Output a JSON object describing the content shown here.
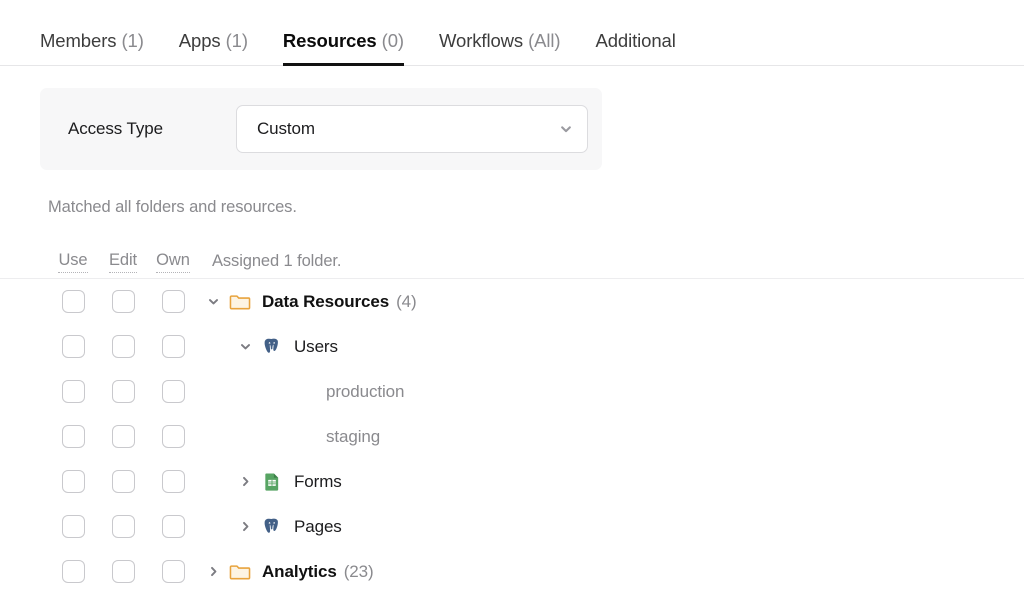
{
  "tabs": [
    {
      "label": "Members",
      "count": "(1)",
      "active": false
    },
    {
      "label": "Apps",
      "count": "(1)",
      "active": false
    },
    {
      "label": "Resources",
      "count": "(0)",
      "active": true
    },
    {
      "label": "Workflows",
      "count": "(All)",
      "active": false
    },
    {
      "label": "Additional",
      "count": "",
      "active": false
    }
  ],
  "access": {
    "label": "Access Type",
    "value": "Custom",
    "chevron_icon": "chevron-down-icon",
    "options": [
      "Custom"
    ]
  },
  "matched_note": "Matched all folders and resources.",
  "permissions": [
    {
      "key": "use",
      "label": "Use"
    },
    {
      "key": "edit",
      "label": "Edit"
    },
    {
      "key": "own",
      "label": "Own"
    }
  ],
  "assigned_note": "Assigned 1 folder.",
  "tree": [
    {
      "label": "Data Resources",
      "count": "(4)",
      "icon": "folder-icon",
      "kind": "folder",
      "depth": 0,
      "twisty": "expanded",
      "use": false,
      "edit": false,
      "own": false
    },
    {
      "label": "Users",
      "count": "",
      "icon": "postgresql-icon",
      "kind": "resource",
      "depth": 1,
      "twisty": "expanded",
      "use": false,
      "edit": false,
      "own": false
    },
    {
      "label": "production",
      "count": "",
      "icon": "",
      "kind": "leaf",
      "depth": 2,
      "twisty": "none",
      "use": false,
      "edit": false,
      "own": false
    },
    {
      "label": "staging",
      "count": "",
      "icon": "",
      "kind": "leaf",
      "depth": 2,
      "twisty": "none",
      "use": false,
      "edit": false,
      "own": false
    },
    {
      "label": "Forms",
      "count": "",
      "icon": "google-sheets-icon",
      "kind": "resource",
      "depth": 1,
      "twisty": "collapsed",
      "use": false,
      "edit": false,
      "own": false
    },
    {
      "label": "Pages",
      "count": "",
      "icon": "postgresql-icon",
      "kind": "resource",
      "depth": 1,
      "twisty": "collapsed",
      "use": false,
      "edit": false,
      "own": false
    },
    {
      "label": "Analytics",
      "count": "(23)",
      "icon": "folder-icon",
      "kind": "folder",
      "depth": 0,
      "twisty": "collapsed",
      "use": false,
      "edit": false,
      "own": false
    }
  ],
  "colors": {
    "folder_stroke": "#e8a33d",
    "folder_fill": "#fdf4e3",
    "postgres": "#436087",
    "sheets_green": "#5bа463",
    "active_tab_underline": "#111111",
    "panel_bg": "#f7f7f8",
    "muted_text": "#8a8a8e"
  }
}
